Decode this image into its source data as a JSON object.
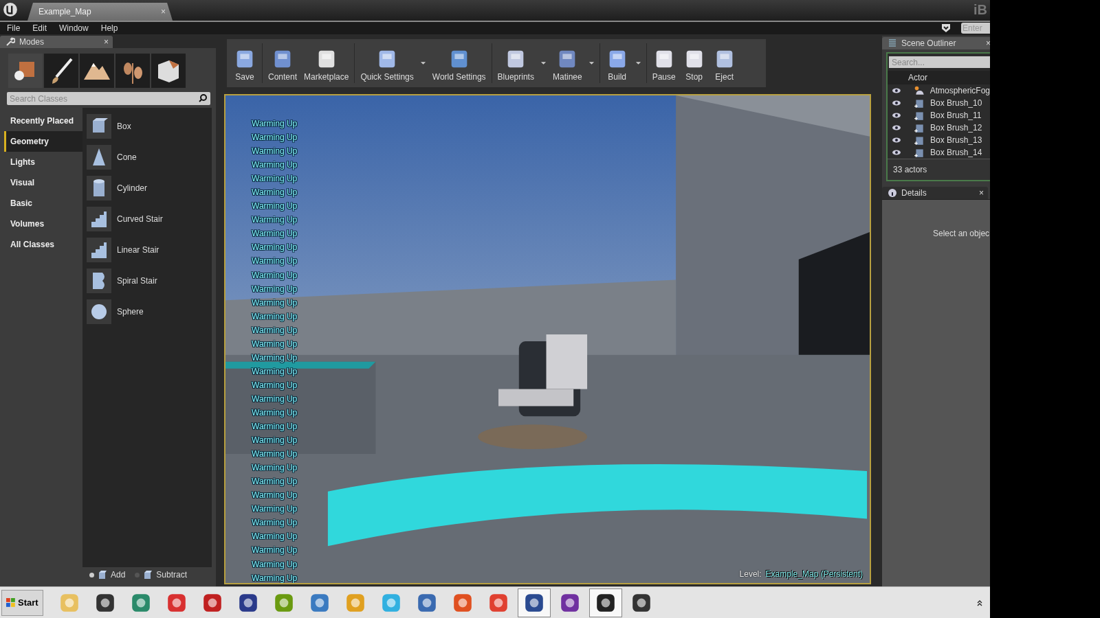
{
  "title_bar": {
    "tab": "Example_Map",
    "close": "×",
    "right_text": "iB"
  },
  "menu": [
    "File",
    "Edit",
    "Window",
    "Help"
  ],
  "search_box": {
    "placeholder": "Enter"
  },
  "modes_panel": {
    "title": "Modes",
    "close": "×",
    "search": {
      "placeholder": "Search Classes"
    },
    "categories": [
      {
        "label": "Recently Placed",
        "selected": false
      },
      {
        "label": "Geometry",
        "selected": true
      },
      {
        "label": "Lights",
        "selected": false
      },
      {
        "label": "Visual",
        "selected": false
      },
      {
        "label": "Basic",
        "selected": false
      },
      {
        "label": "Volumes",
        "selected": false
      },
      {
        "label": "All Classes",
        "selected": false
      }
    ],
    "items": [
      {
        "label": "Box",
        "kind": "box"
      },
      {
        "label": "Cone",
        "kind": "cone"
      },
      {
        "label": "Cylinder",
        "kind": "cylinder"
      },
      {
        "label": "Curved Stair",
        "kind": "stair"
      },
      {
        "label": "Linear Stair",
        "kind": "stair"
      },
      {
        "label": "Spiral Stair",
        "kind": "spiral"
      },
      {
        "label": "Sphere",
        "kind": "sphere"
      }
    ],
    "brush_modes": [
      {
        "label": "Add",
        "selected": true
      },
      {
        "label": "Subtract",
        "selected": false
      }
    ]
  },
  "toolbar": [
    {
      "label": "Save",
      "dropdown": false,
      "separator_after": true
    },
    {
      "label": "Content",
      "dropdown": false,
      "separator_after": false
    },
    {
      "label": "Marketplace",
      "dropdown": false,
      "separator_after": true
    },
    {
      "label": "Quick Settings",
      "dropdown": true,
      "separator_after": false
    },
    {
      "label": "World Settings",
      "dropdown": false,
      "separator_after": true
    },
    {
      "label": "Blueprints",
      "dropdown": true,
      "separator_after": false
    },
    {
      "label": "Matinee",
      "dropdown": true,
      "separator_after": true
    },
    {
      "label": "Build",
      "dropdown": true,
      "separator_after": true
    },
    {
      "label": "Pause",
      "dropdown": false,
      "separator_after": false
    },
    {
      "label": "Stop",
      "dropdown": false,
      "separator_after": false
    },
    {
      "label": "Eject",
      "dropdown": false,
      "separator_after": false
    }
  ],
  "viewport": {
    "messages": [
      "Warming Up",
      "Warming Up",
      "Warming Up",
      "Warming Up",
      "Warming Up",
      "Warming Up",
      "Warming Up",
      "Warming Up",
      "Warming Up",
      "Warming Up",
      "Warming Up",
      "Warming Up",
      "Warming Up",
      "Warming Up",
      "Warming Up",
      "Warming Up",
      "Warming Up",
      "Warming Up",
      "Warming Up",
      "Warming Up",
      "Warming Up",
      "Warming Up",
      "Warming Up",
      "Warming Up",
      "Warming Up",
      "Warming Up",
      "Warming Up",
      "Warming Up",
      "Warming Up",
      "Warming Up",
      "Warming Up",
      "Warming Up",
      "Warming Up",
      "Warming Up"
    ],
    "level_label": "Level:",
    "level_name": "Example_Map (Persistent)"
  },
  "scene_outliner": {
    "title": "Scene Outliner",
    "close": "×",
    "search": {
      "placeholder": "Search..."
    },
    "column": "Actor",
    "rows": [
      {
        "name": "AtmosphericFog",
        "kind": "fog"
      },
      {
        "name": "Box Brush_10",
        "kind": "brush"
      },
      {
        "name": "Box Brush_11",
        "kind": "brush"
      },
      {
        "name": "Box Brush_12",
        "kind": "brush"
      },
      {
        "name": "Box Brush_13",
        "kind": "brush"
      },
      {
        "name": "Box Brush_14",
        "kind": "brush"
      }
    ],
    "count": "33 actors"
  },
  "details": {
    "title": "Details",
    "close": "×",
    "empty_text": "Select an objec"
  },
  "taskbar": {
    "start": "Start",
    "apps": [
      {
        "pressed": false
      },
      {
        "pressed": false
      },
      {
        "pressed": false
      },
      {
        "pressed": false
      },
      {
        "pressed": false
      },
      {
        "pressed": false
      },
      {
        "pressed": false
      },
      {
        "pressed": false
      },
      {
        "pressed": false
      },
      {
        "pressed": false
      },
      {
        "pressed": false
      },
      {
        "pressed": false
      },
      {
        "pressed": false
      },
      {
        "pressed": true
      },
      {
        "pressed": false
      },
      {
        "pressed": true
      },
      {
        "pressed": false
      }
    ]
  }
}
